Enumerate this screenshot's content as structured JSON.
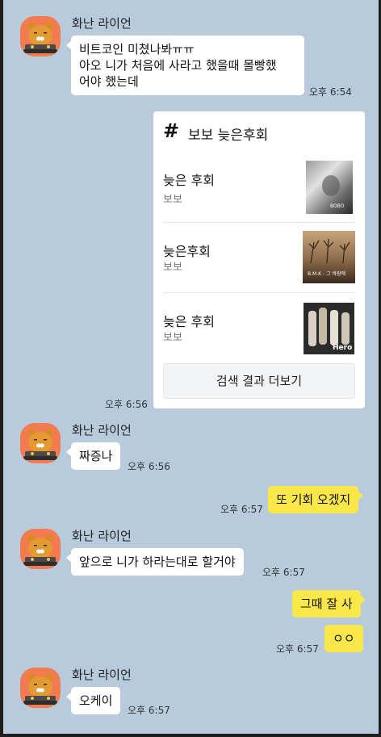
{
  "colors": {
    "background": "#b7cbdd",
    "my_bubble": "#fae84a",
    "their_bubble": "#ffffff",
    "avatar": "#f47a4f"
  },
  "sender_name": "화난 라이언",
  "messages": [
    {
      "lines": [
        "비트코인 미쳤나봐ㅠㅠ",
        "아오 니가 처음에 사라고 했을때 몰빵했",
        "어야 했는데"
      ],
      "time": "오후 6:54"
    },
    {
      "text": "짜증나",
      "time": "오후 6:56"
    },
    {
      "text": "또 기회 오겠지",
      "time": "오후 6:57"
    },
    {
      "text": "앞으로 니가 하라는대로 할거야",
      "time": "오후 6:57"
    },
    {
      "text": "그때 잘 사",
      "time": ""
    },
    {
      "text": "ㅇㅇ",
      "time": "오후 6:57"
    },
    {
      "text": "오케이",
      "time": "오후 6:57"
    }
  ],
  "search_card": {
    "hash_icon": "#",
    "title": "보보 늦은후회",
    "time": "오후 6:56",
    "results": [
      {
        "title": "늦은 후회",
        "artist": "보보",
        "thumb_text": "BOBO"
      },
      {
        "title": "늦은후회",
        "artist": "보보",
        "thumb_text": "B.M.K - 그 바람에"
      },
      {
        "title": "늦은 후회",
        "artist": "보보",
        "thumb_text": "Hero"
      }
    ],
    "more_label": "검색 결과 더보기"
  }
}
